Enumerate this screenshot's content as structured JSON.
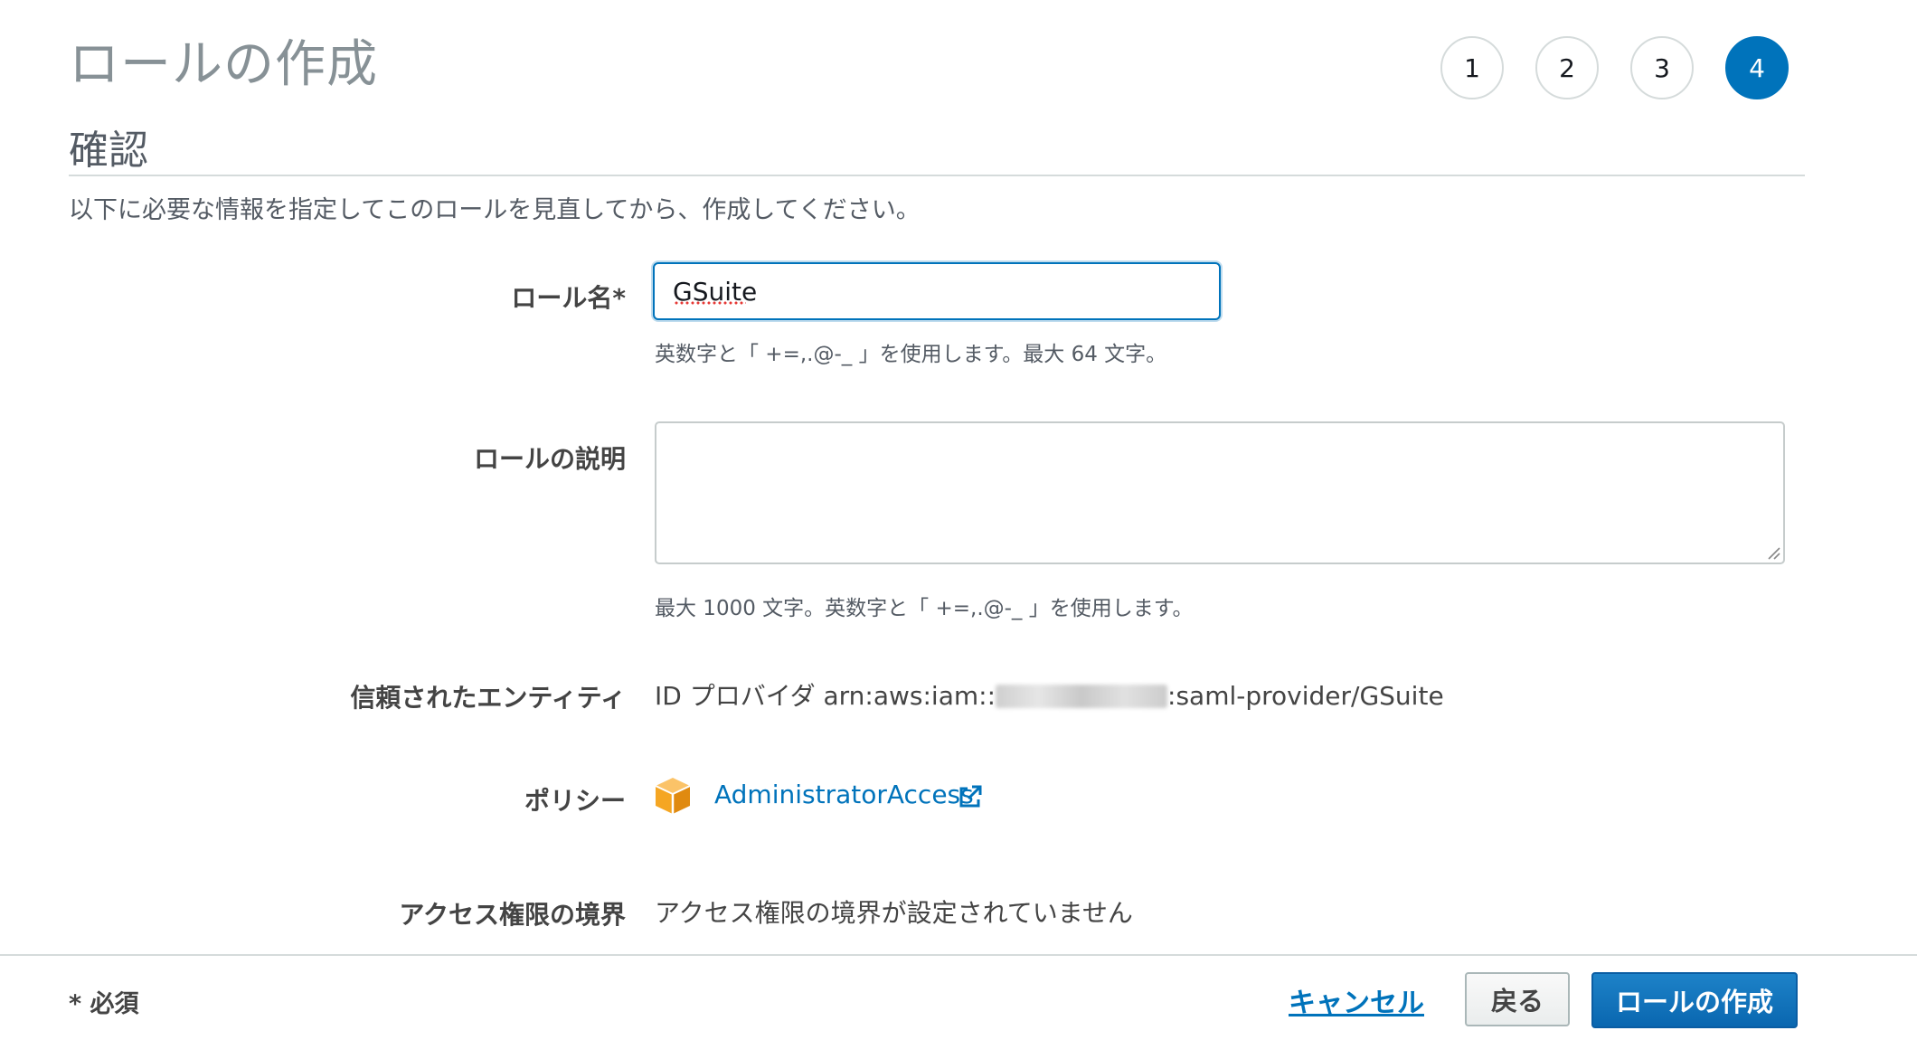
{
  "page_title": "ロールの作成",
  "steps": [
    {
      "label": "1",
      "active": false
    },
    {
      "label": "2",
      "active": false
    },
    {
      "label": "3",
      "active": false
    },
    {
      "label": "4",
      "active": true
    }
  ],
  "section_title": "確認",
  "intro": "以下に必要な情報を指定してこのロールを見直してから、作成してください。",
  "role_name": {
    "label": "ロール名*",
    "value": "GSuite",
    "hint": "英数字と「 +=,.@-_ 」を使用します。最大 64 文字。"
  },
  "role_description": {
    "label": "ロールの説明",
    "value": "",
    "hint": "最大 1000 文字。英数字と「 +=,.@-_ 」を使用します。"
  },
  "trusted_entity": {
    "label": "信頼されたエンティティ",
    "prefix": "ID プロバイダ arn:aws:iam::",
    "suffix": ":saml-provider/GSuite"
  },
  "policy": {
    "label": "ポリシー",
    "link_text": "AdministratorAccess",
    "icon": "policy-cube-icon"
  },
  "permissions_boundary": {
    "label": "アクセス権限の境界",
    "value": "アクセス権限の境界が設定されていません"
  },
  "footer": {
    "required_note": "* 必須",
    "cancel_label": "キャンセル",
    "back_label": "戻る",
    "create_label": "ロールの作成"
  },
  "colors": {
    "primary": "#0073bb",
    "title_gray": "#879196",
    "divider": "#d5dbdb",
    "policy_icon": "#f5a623"
  }
}
